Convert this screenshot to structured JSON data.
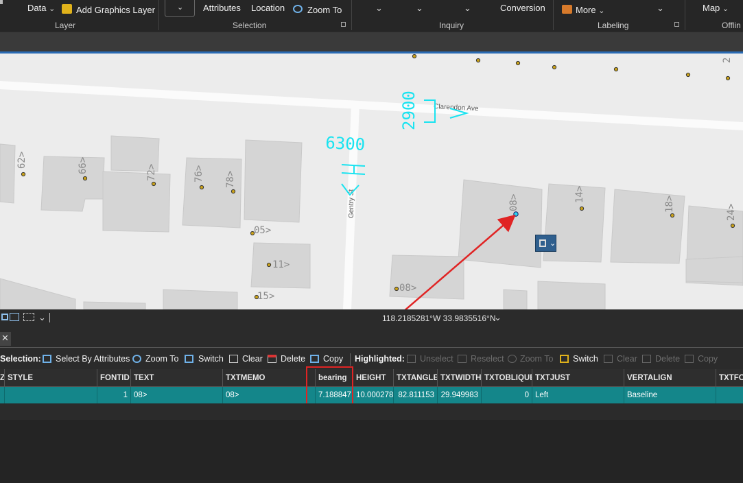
{
  "ribbon": {
    "data_label": "Data",
    "add_graphics_label": "Add Graphics Layer",
    "layer_group": "Layer",
    "attributes_label": "Attributes",
    "location_label": "Location",
    "zoom_to_label": "Zoom To",
    "selection_group": "Selection",
    "inquiry_group": "Inquiry",
    "conversion_label": "Conversion",
    "more_label": "More",
    "labeling_group": "Labeling",
    "map_label": "Map",
    "offline_group": "Offlin"
  },
  "map": {
    "street_clarendon": "Clarendon Ave",
    "street_gentry": "Gentry St",
    "dim_6300": "6300",
    "dim_2900": "2900",
    "parcel_labels": [
      "62>",
      "66>",
      "72>",
      "76>",
      "78>",
      "05>",
      "11>",
      "15>",
      "08>",
      "14>",
      "18>",
      "24>",
      "08>",
      "2"
    ],
    "annotation_arrow_color": "#e02424",
    "dimension_color": "#19e3f0"
  },
  "statusbar": {
    "coordinates": "118.2185281°W 33.9835516°N"
  },
  "table_toolbar": {
    "selection_label": "Selection:",
    "select_by_attributes": "Select By Attributes",
    "zoom_to": "Zoom To",
    "switch": "Switch",
    "clear": "Clear",
    "delete": "Delete",
    "copy": "Copy",
    "highlighted_label": "Highlighted:",
    "unselect": "Unselect",
    "reselect": "Reselect",
    "h_zoom_to": "Zoom To",
    "h_switch": "Switch",
    "h_clear": "Clear",
    "h_delete": "Delete",
    "h_copy": "Copy"
  },
  "table": {
    "columns": [
      "Z",
      "STYLE",
      "FONTID",
      "TEXT",
      "TXTMEMO",
      "bearing",
      "HEIGHT",
      "TXTANGLE",
      "TXTWIDTH",
      "TXTOBLIQUE",
      "TXTJUST",
      "VERTALIGN",
      "TXTFO"
    ],
    "row": [
      "",
      "",
      "1",
      "08>",
      "08>",
      "7.188847",
      "10.000278",
      "82.811153",
      "29.949983",
      "0",
      "Left",
      "Baseline",
      ""
    ]
  },
  "colors": {
    "accent_blue": "#2a6bb4",
    "selected_row": "#14868a",
    "highlight_box": "#e02424"
  }
}
